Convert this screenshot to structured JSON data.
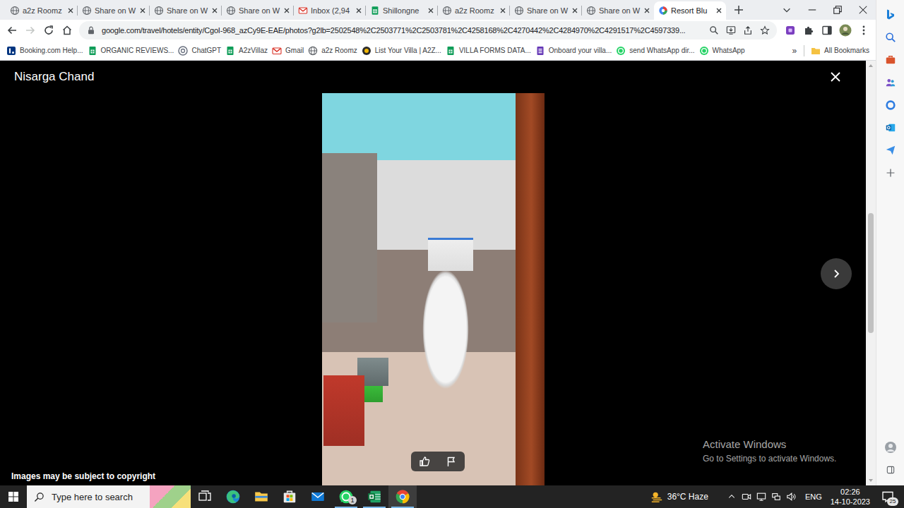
{
  "browser": {
    "tabs": [
      {
        "label": "a2z Roomz",
        "kind": "globe",
        "selected": false
      },
      {
        "label": "Share on W",
        "kind": "globe",
        "selected": false
      },
      {
        "label": "Share on W",
        "kind": "globe",
        "selected": false
      },
      {
        "label": "Share on W",
        "kind": "globe",
        "selected": false
      },
      {
        "label": "Inbox (2,94",
        "kind": "gmail",
        "selected": false
      },
      {
        "label": "Shillongne",
        "kind": "sheets",
        "selected": false
      },
      {
        "label": "a2z Roomz",
        "kind": "globe",
        "selected": false
      },
      {
        "label": "Share on W",
        "kind": "globe",
        "selected": false
      },
      {
        "label": "Share on W",
        "kind": "globe",
        "selected": false
      },
      {
        "label": "Resort Blu",
        "kind": "travel",
        "selected": true
      }
    ],
    "back_enabled": true,
    "forward_enabled": false,
    "address": "google.com/travel/hotels/entity/CgoI-968_azCy9E-EAE/photos?g2lb=2502548%2C2503771%2C2503781%2C4258168%2C4270442%2C4284970%2C4291517%2C4597339...",
    "bookmarks": [
      {
        "label": "Booking.com Help...",
        "kind": "booking"
      },
      {
        "label": "ORGANIC REVIEWS...",
        "kind": "sheets"
      },
      {
        "label": "ChatGPT",
        "kind": "chatgpt"
      },
      {
        "label": "A2zVillaz",
        "kind": "sheets"
      },
      {
        "label": "Gmail",
        "kind": "gmail"
      },
      {
        "label": "a2z Roomz",
        "kind": "globe"
      },
      {
        "label": "List Your Villa | A2Z...",
        "kind": "a2z"
      },
      {
        "label": "VILLA FORMS DATA...",
        "kind": "sheets"
      },
      {
        "label": "Onboard your villa...",
        "kind": "form"
      },
      {
        "label": "send WhatsApp dir...",
        "kind": "whatsapp"
      },
      {
        "label": "WhatsApp",
        "kind": "whatsapp"
      }
    ],
    "more_bookmarks": "»",
    "all_bookmarks": "All Bookmarks",
    "scrollbar": {
      "level": 0.5
    }
  },
  "viewer": {
    "title": "Nisarga Chand",
    "copyright": "Images may be subject to copyright"
  },
  "watermark": {
    "title": "Activate Windows",
    "subtitle": "Go to Settings to activate Windows."
  },
  "taskbar": {
    "search_placeholder": "Type here to search",
    "apps": [
      {
        "kind": "taskview",
        "running": false,
        "selected": false,
        "badge": ""
      },
      {
        "kind": "edge",
        "running": false,
        "selected": false,
        "badge": ""
      },
      {
        "kind": "explorer",
        "running": false,
        "selected": false,
        "badge": ""
      },
      {
        "kind": "store",
        "running": false,
        "selected": false,
        "badge": ""
      },
      {
        "kind": "mail",
        "running": false,
        "selected": false,
        "badge": ""
      },
      {
        "kind": "whatsapp",
        "running": true,
        "selected": false,
        "badge": "1"
      },
      {
        "kind": "excel",
        "running": true,
        "selected": false,
        "badge": ""
      },
      {
        "kind": "chrome",
        "running": true,
        "selected": true,
        "badge": ""
      }
    ],
    "weather": "36°C Haze",
    "language": "ENG",
    "time": "02:26",
    "date": "14-10-2023",
    "notifications": "25"
  }
}
